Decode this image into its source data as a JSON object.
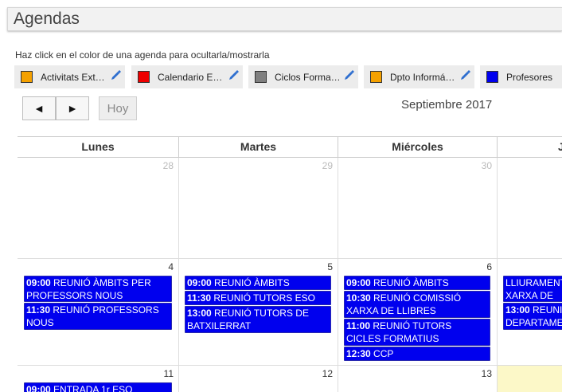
{
  "header": {
    "title": "Agendas"
  },
  "hint": "Haz click en el color de una agenda para ocultarla/mostrarla",
  "agendas": [
    {
      "name": "Activitats Ext…",
      "color": "#f5a100",
      "editable": true
    },
    {
      "name": "Calendario E…",
      "color": "#ee0000",
      "editable": true
    },
    {
      "name": "Ciclos Forma…",
      "color": "#808080",
      "editable": true
    },
    {
      "name": "Dpto Informá…",
      "color": "#f5a100",
      "editable": true
    },
    {
      "name": "Profesores",
      "color": "#0000ee",
      "editable": false
    }
  ],
  "nav": {
    "prev": "◄",
    "next": "►",
    "today": "Hoy"
  },
  "month_label": "Septiembre 2017",
  "days": [
    "Lunes",
    "Martes",
    "Miércoles",
    "J"
  ],
  "weeks": [
    {
      "dates": [
        "28",
        "29",
        "30",
        ""
      ]
    },
    {
      "dates": [
        "4",
        "5",
        "6",
        ""
      ]
    },
    {
      "dates": [
        "11",
        "12",
        "13",
        ""
      ]
    }
  ],
  "events": {
    "w1_mon": [
      {
        "time": "09:00",
        "title": "REUNIÓ ÀMBITS PER PROFESSORS NOUS"
      },
      {
        "time": "11:30",
        "title": "REUNIÓ PROFESSORS NOUS"
      }
    ],
    "w1_tue": [
      {
        "time": "09:00",
        "title": "REUNIÓ ÀMBITS"
      },
      {
        "time": "11:30",
        "title": "REUNIÓ TUTORS ESO"
      },
      {
        "time": "13:00",
        "title": "REUNIÓ TUTORS DE BATXILERRAT"
      }
    ],
    "w1_wed": [
      {
        "time": "09:00",
        "title": "REUNIÓ ÀMBITS"
      },
      {
        "time": "10:30",
        "title": "REUNIÓ COMISSIÓ XARXA DE LLIBRES"
      },
      {
        "time": "11:00",
        "title": "REUNIÓ TUTORS CICLES FORMATIUS"
      },
      {
        "time": "12:30",
        "title": "CCP"
      }
    ],
    "w1_thu": [
      {
        "time": "",
        "title": "LLIURAMENT XARXA DE LLI"
      },
      {
        "time": "13:00",
        "title": "REUNI DEPARTAMEN"
      }
    ],
    "w2_mon": [
      {
        "time": "09:00",
        "title": "ENTRADA 1r ESO"
      }
    ]
  }
}
